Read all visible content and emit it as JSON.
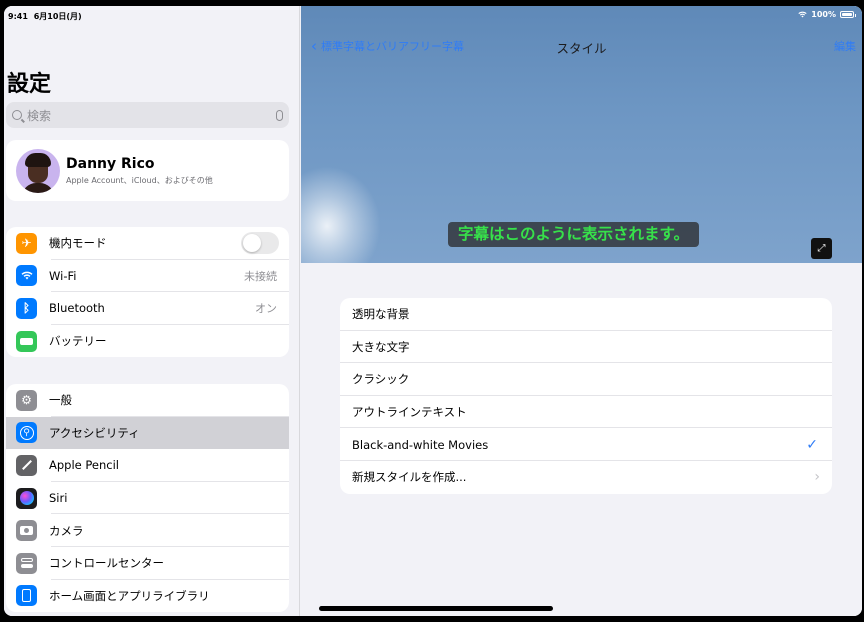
{
  "status": {
    "time": "9:41",
    "date": "6月10日(月)",
    "battery": "100%"
  },
  "sidebar": {
    "title": "設定",
    "search_placeholder": "検索",
    "profile": {
      "name": "Danny Rico",
      "subtitle": "Apple Account、iCloud、およびその他"
    },
    "group1": [
      {
        "label": "機内モード",
        "icon": "airplane-icon",
        "color": "#ff9500",
        "toggle": false
      },
      {
        "label": "Wi-Fi",
        "icon": "wifi-icon",
        "color": "#007aff",
        "value": "未接続"
      },
      {
        "label": "Bluetooth",
        "icon": "bluetooth-icon",
        "color": "#007aff",
        "value": "オン"
      },
      {
        "label": "バッテリー",
        "icon": "battery-icon",
        "color": "#34c759"
      }
    ],
    "group2": [
      {
        "label": "一般",
        "icon": "gear-icon",
        "color": "#8e8e93"
      },
      {
        "label": "アクセシビリティ",
        "icon": "accessibility-icon",
        "color": "#007aff",
        "selected": true
      },
      {
        "label": "Apple Pencil",
        "icon": "pencil-icon",
        "color": "#636366"
      },
      {
        "label": "Siri",
        "icon": "siri-icon",
        "color": "#1c1c1e"
      },
      {
        "label": "カメラ",
        "icon": "camera-icon",
        "color": "#8e8e93"
      },
      {
        "label": "コントロールセンター",
        "icon": "control-center-icon",
        "color": "#8e8e93"
      },
      {
        "label": "ホーム画面とアプリライブラリ",
        "icon": "home-screen-icon",
        "color": "#007aff"
      }
    ]
  },
  "detail": {
    "nav": {
      "back_label": "標準字幕とバリアフリー字幕",
      "title": "スタイル",
      "edit_label": "編集"
    },
    "caption_preview": "字幕はこのように表示されます。",
    "styles": [
      {
        "label": "透明な背景"
      },
      {
        "label": "大きな文字"
      },
      {
        "label": "クラシック"
      },
      {
        "label": "アウトラインテキスト"
      },
      {
        "label": "Black-and-white Movies",
        "checked": true
      },
      {
        "label": "新規スタイルを作成...",
        "chevron": true
      }
    ]
  }
}
